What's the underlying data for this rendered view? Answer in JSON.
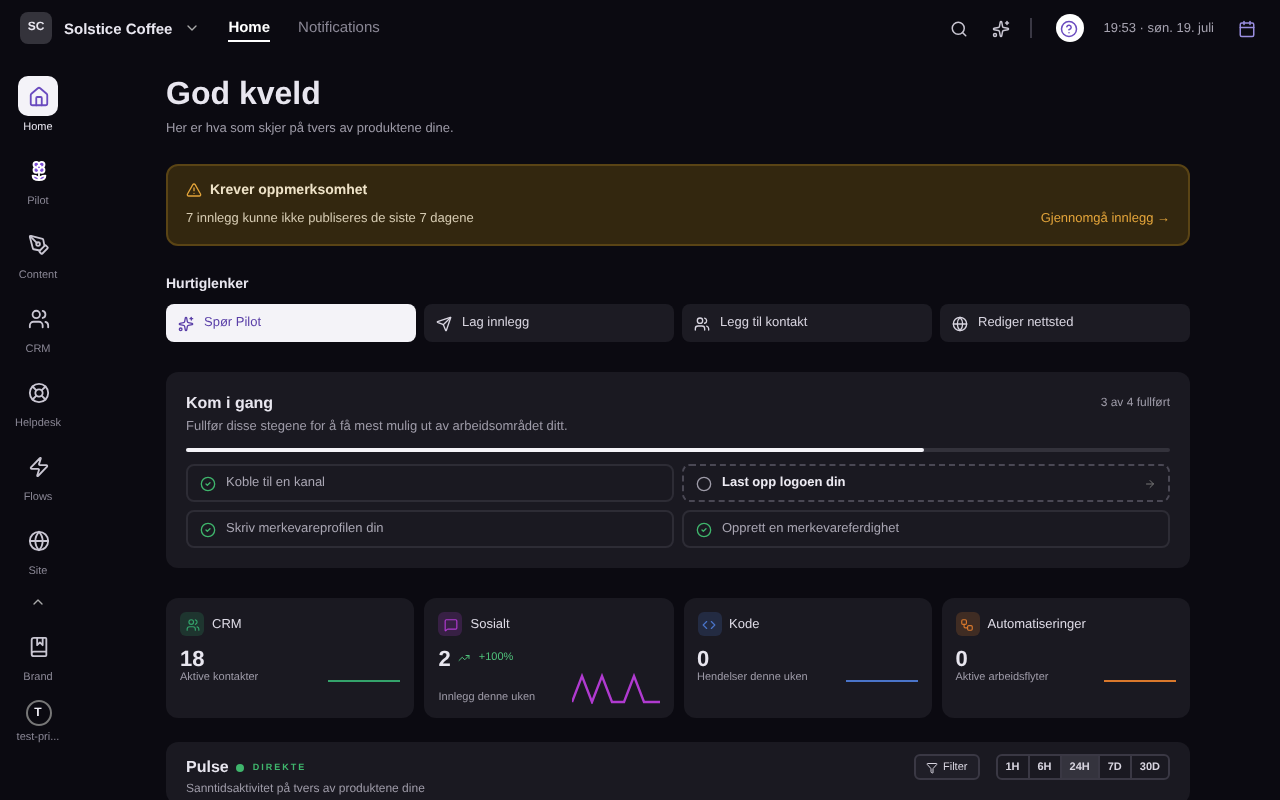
{
  "workspace": {
    "initials": "SC",
    "name": "Solstice Coffee"
  },
  "top_tabs": [
    {
      "label": "Home",
      "selected": true
    },
    {
      "label": "Notifications",
      "selected": false
    }
  ],
  "clock": "19:53 · søn. 19. juli",
  "sidebar": {
    "items": [
      {
        "label": "Home",
        "selected": true
      },
      {
        "label": "Pilot",
        "selected": false
      },
      {
        "label": "Content",
        "selected": false
      },
      {
        "label": "CRM",
        "selected": false
      },
      {
        "label": "Helpdesk",
        "selected": false
      },
      {
        "label": "Flows",
        "selected": false
      },
      {
        "label": "Site",
        "selected": false
      }
    ],
    "bottom_items": [
      {
        "label": "Brand",
        "selected": false
      }
    ],
    "user": {
      "initial": "T",
      "name": "test-pri..."
    }
  },
  "greeting": {
    "title": "God kveld",
    "subtitle": "Her er hva som skjer på tvers av produktene dine."
  },
  "alert": {
    "title": "Krever oppmerksomhet",
    "message": "7 innlegg kunne ikke publiseres de siste 7 dagene",
    "action": "Gjennomgå innlegg →"
  },
  "quick_links": {
    "title": "Hurtiglenker",
    "items": [
      {
        "label": "Spør Pilot",
        "selected": true
      },
      {
        "label": "Lag innlegg",
        "selected": false
      },
      {
        "label": "Legg til kontakt",
        "selected": false
      },
      {
        "label": "Rediger nettsted",
        "selected": false
      }
    ]
  },
  "getting_started": {
    "title": "Kom i gang",
    "subtitle": "Fullfør disse stegene for å få mest mulig ut av arbeidsområdet ditt.",
    "count": "3 av 4 fullført",
    "level": 0.75,
    "steps": [
      {
        "label": "Koble til en kanal",
        "done": true
      },
      {
        "label": "Last opp logoen din",
        "done": false
      },
      {
        "label": "Skriv merkevareprofilen din",
        "done": true
      },
      {
        "label": "Opprett en merkevareferdighet",
        "done": true
      }
    ]
  },
  "stats": [
    {
      "title": "CRM",
      "color": "#34a36b",
      "value": "18",
      "label": "Aktive kontakter"
    },
    {
      "title": "Sosialt",
      "color": "#b03ad0",
      "value": "2",
      "delta": "+100%",
      "label": "Innlegg denne uken"
    },
    {
      "title": "Kode",
      "color": "#4a74c9",
      "value": "0",
      "label": "Hendelser denne uken"
    },
    {
      "title": "Automatiseringer",
      "color": "#d9782c",
      "value": "0",
      "label": "Aktive arbeidsflyter"
    }
  ],
  "pulse": {
    "title": "Pulse",
    "badge": "DIREKTE",
    "subtitle": "Sanntidsaktivitet på tvers av produktene dine",
    "filter": "Filter",
    "ranges": [
      {
        "label": "1H",
        "selected": false
      },
      {
        "label": "6H",
        "selected": false
      },
      {
        "label": "24H",
        "selected": true
      },
      {
        "label": "7D",
        "selected": false
      },
      {
        "label": "30D",
        "selected": false
      }
    ]
  }
}
